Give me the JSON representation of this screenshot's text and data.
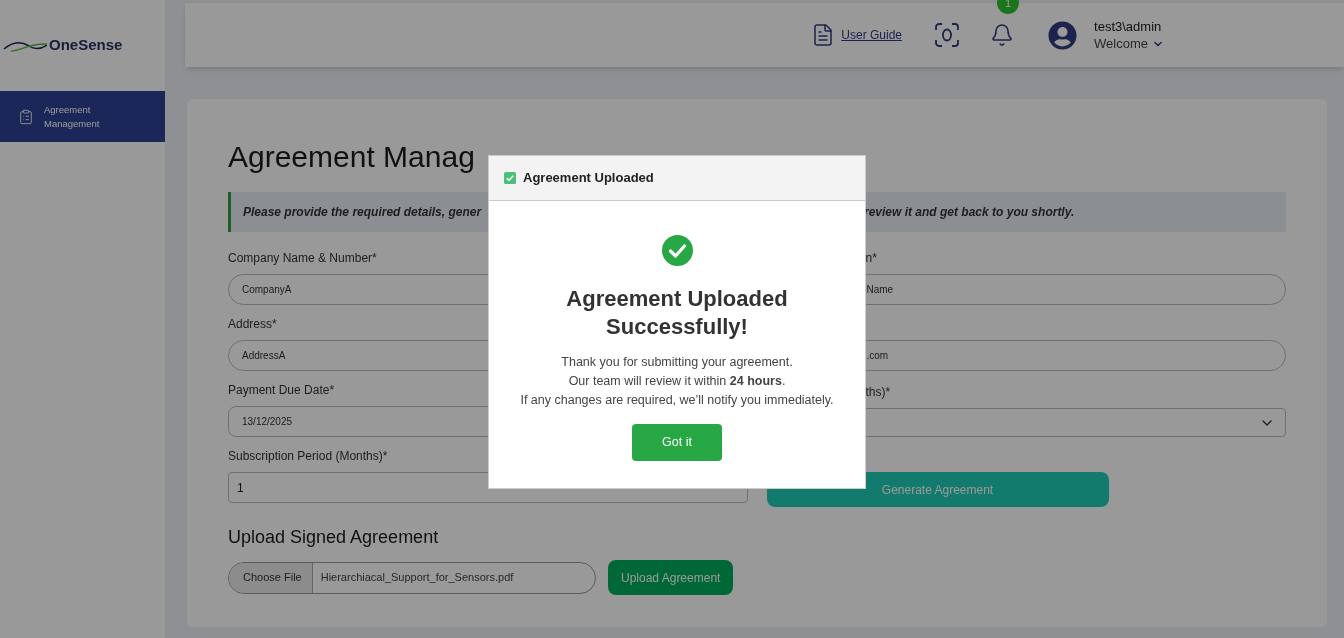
{
  "sidebar": {
    "logo": "OneSense",
    "items": [
      {
        "label": "Agreement Management",
        "selected": true
      }
    ]
  },
  "header": {
    "user_guide": "User Guide",
    "notification_count": "1",
    "user_name": "test3\\admin",
    "greeting": "Welcome"
  },
  "page": {
    "title": "Agreement Manag",
    "notice": [
      "Please provide the required details, gener",
      "review it and get back to you shortly."
    ],
    "rows": [
      {
        "left": {
          "label": "Company Name & Number*",
          "value": "CompanyA",
          "kind": "pill"
        },
        "right": {
          "label": "n*",
          "value": "Name",
          "kind": "pill"
        }
      },
      {
        "left": {
          "label": "Address*",
          "value": "AddressA",
          "kind": "pill"
        },
        "right": {
          "value": ".com",
          "kind": "pill"
        }
      },
      {
        "left": {
          "label": "Payment Due Date*",
          "value": "13/12/2025",
          "kind": "date"
        },
        "right": {
          "label": "ths)*",
          "kind": "select"
        }
      },
      {
        "left": {
          "label": "Subscription Period (Months)*",
          "value": "1",
          "kind": "text"
        },
        "right": {
          "value": "Generate Agreement",
          "kind": "button"
        }
      }
    ],
    "upload": {
      "title": "Upload Signed Agreement",
      "choose_button": "Choose File",
      "file_name": "Hierarchiacal_Support_for_Sensors.pdf",
      "upload_button": "Upload Agreement"
    }
  },
  "modal": {
    "title": "Agreement Uploaded",
    "heading": "Agreement Uploaded Successfully!",
    "lines": [
      "Thank you for submitting your agreement.",
      "Our team will review it within **24 hours**.",
      "If any changes are required, we’ll notify you immediately."
    ],
    "button": "Got it"
  }
}
